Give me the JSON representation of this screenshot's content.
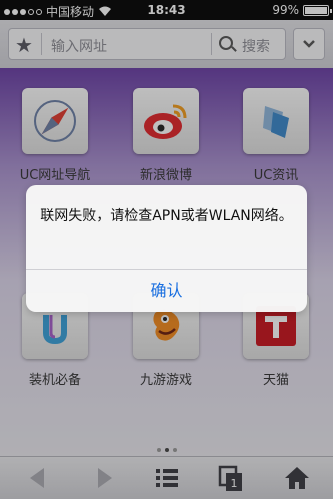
{
  "statusbar": {
    "carrier": "中国移动",
    "time": "18:43",
    "battery": "99%",
    "battery_level": 0.99
  },
  "address_bar": {
    "url_placeholder": "输入网址",
    "search_label": "搜索"
  },
  "tiles": [
    {
      "label": "UC网址导航",
      "icon": "compass-icon"
    },
    {
      "label": "新浪微博",
      "icon": "weibo-icon"
    },
    {
      "label": "UC资讯",
      "icon": "uc-news-icon"
    },
    {
      "label": "装机必备",
      "icon": "essentials-icon"
    },
    {
      "label": "九游游戏",
      "icon": "9game-icon"
    },
    {
      "label": "天猫",
      "icon": "tmall-icon"
    }
  ],
  "alert": {
    "message": "联网失败，请检查APN或者WLAN网络。",
    "confirm_label": "确认"
  },
  "colors": {
    "accent": "#1a6fe0",
    "tmall_red": "#c8141e",
    "weibo_red": "#e1242a"
  }
}
